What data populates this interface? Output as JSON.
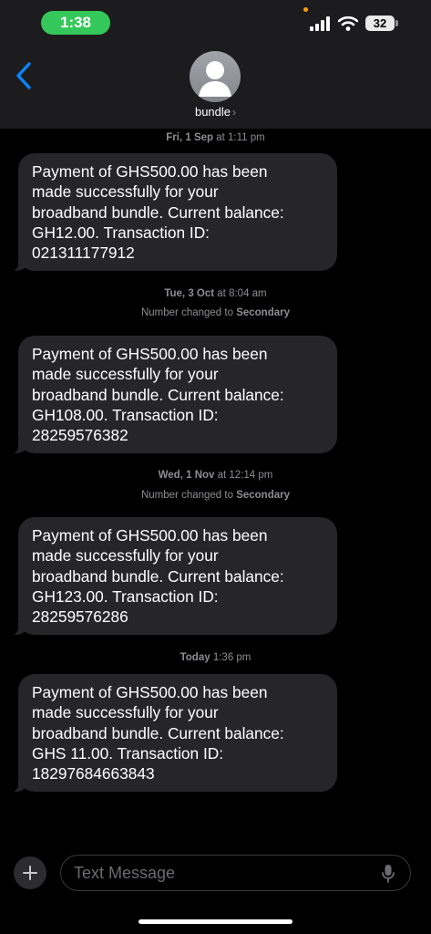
{
  "status_bar": {
    "time": "1:38",
    "battery": "32",
    "icons": [
      "signal-icon",
      "wifi-icon",
      "battery-icon"
    ]
  },
  "header": {
    "contact_name": "bundle",
    "chevron": "›",
    "icons": [
      "back-chevron-icon",
      "avatar-person-icon"
    ]
  },
  "thread": {
    "timestamps": [
      {
        "day": "Fri, 1 Sep",
        "time": "1:11 pm"
      },
      {
        "day": "Tue, 3 Oct",
        "time": "8:04 am"
      },
      {
        "day": "Wed, 1 Nov",
        "time": "12:14 pm"
      },
      {
        "day": "Today",
        "time": "1:36 pm"
      }
    ],
    "number_changed": {
      "prefix": "Number changed to ",
      "line": "Secondary"
    },
    "messages": [
      {
        "lines": [
          "Payment of GHS500.00 has been",
          "made successfully for your",
          "broadband bundle. Current balance:",
          "GH12.00. Transaction ID:",
          "021311177912"
        ]
      },
      {
        "lines": [
          "Payment of GHS500.00 has been",
          "made successfully for your",
          "broadband bundle. Current balance:",
          "GH108.00. Transaction ID:",
          "28259576382"
        ]
      },
      {
        "lines": [
          "Payment of GHS500.00 has been",
          "made successfully for your",
          "broadband bundle. Current balance:",
          "GH123.00. Transaction ID:",
          "28259576286"
        ]
      },
      {
        "lines": [
          "Payment of GHS500.00 has been",
          "made successfully for your",
          "broadband bundle. Current balance:",
          "GHS 11.00. Transaction ID:",
          "18297684663843"
        ]
      }
    ]
  },
  "composer": {
    "placeholder": "Text Message",
    "icons": [
      "plus-icon",
      "microphone-icon"
    ]
  },
  "colors": {
    "accent": "#0a84ff",
    "time_pill": "#34c759",
    "bubble": "#262629",
    "background": "#000000"
  }
}
